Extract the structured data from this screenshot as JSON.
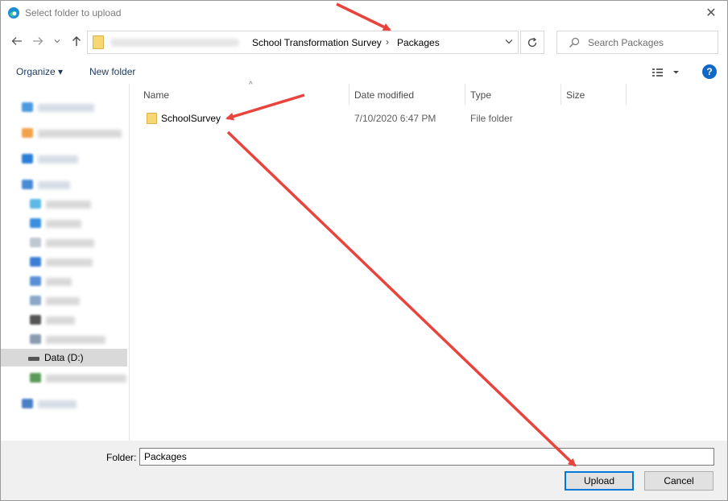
{
  "window": {
    "title": "Select folder to upload",
    "close_glyph": "✕"
  },
  "nav": {
    "back_icon": "back-arrow-icon",
    "forward_icon": "forward-arrow-icon",
    "recent_icon": "chevron-down-icon",
    "up_icon": "up-arrow-icon",
    "breadcrumbs": [
      "School Transformation Survey",
      "Packages"
    ],
    "refresh_icon": "refresh-icon"
  },
  "search": {
    "placeholder": "Search Packages"
  },
  "toolbar": {
    "organize_label": "Organize ▾",
    "new_folder_label": "New folder",
    "help_label": "?"
  },
  "navpane": {
    "selected_label": "Data (D:)"
  },
  "columns": {
    "name": "Name",
    "date_modified": "Date modified",
    "type": "Type",
    "size": "Size"
  },
  "files": [
    {
      "name": "SchoolSurvey",
      "date_modified": "7/10/2020 6:47 PM",
      "type": "File folder",
      "size": ""
    }
  ],
  "footer": {
    "folder_label": "Folder:",
    "folder_value": "Packages",
    "upload_label": "Upload",
    "cancel_label": "Cancel"
  },
  "colors": {
    "accent": "#0078d7",
    "arrow": "#e8443d",
    "folder": "#f7d774",
    "help": "#1168c6"
  }
}
